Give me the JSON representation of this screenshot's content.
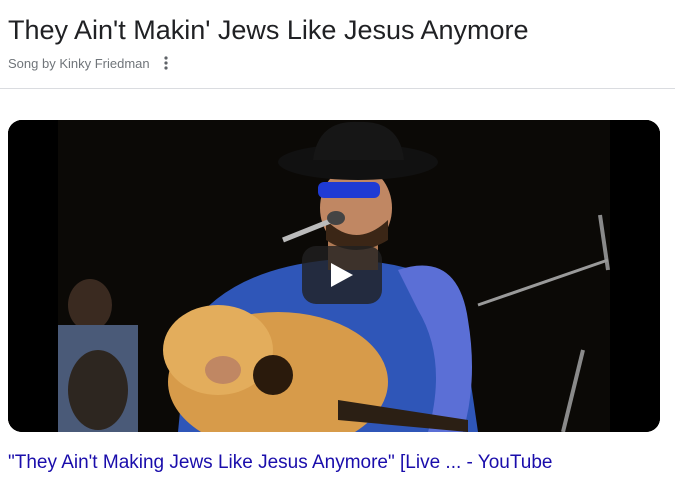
{
  "header": {
    "title": "They Ain't Makin' Jews Like Jesus Anymore",
    "subtitle": "Song by Kinky Friedman",
    "more_icon": "more-vert-icon"
  },
  "video": {
    "thumbnail_icon": "video-thumbnail",
    "play_icon": "play-icon"
  },
  "result": {
    "link_text": "\"They Ain't Making Jews Like Jesus Anymore\" [Live ... - YouTube",
    "link_color": "#1a0dab"
  },
  "colors": {
    "title": "#202124",
    "subtitle": "#70757a",
    "divider": "#dadce0"
  }
}
